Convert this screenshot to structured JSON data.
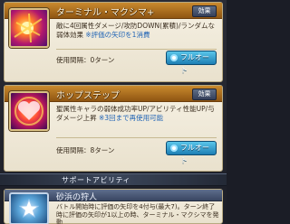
{
  "skills": [
    {
      "name": "ターミナル・マクシマ+",
      "effect_label": "効果",
      "desc_prefix": "敵に4回属性ダメージ/攻防DOWN(累積)/ランダムな弱体効果",
      "desc_highlight": "※評価の矢印を1消費",
      "cooldown_label": "使用間隔：0ターン",
      "auto_label": "フルオート"
    },
    {
      "name": "ホップステップ",
      "effect_label": "効果",
      "desc_prefix": "聖属性キャラの弱体成功率UP/アビリティ性能UP/与ダメージ上昇",
      "desc_highlight": "※3回まで再使用可能",
      "cooldown_label": "使用間隔：8ターン",
      "auto_label": "フルオート"
    }
  ],
  "support_section_title": "サポートアビリティ",
  "support": {
    "name": "砂浜の狩人",
    "desc": "バトル開始時に評価の矢印を4付与(最大7)。ターン終了時に評価の矢印が1以上の時、ターミナル・マクシマを発動"
  },
  "colors": {
    "skill_header": "#c98a2e",
    "support_header": "#5e6e8c",
    "auto_button": "#1e7fb4",
    "highlight_text": "#1f63b5"
  }
}
